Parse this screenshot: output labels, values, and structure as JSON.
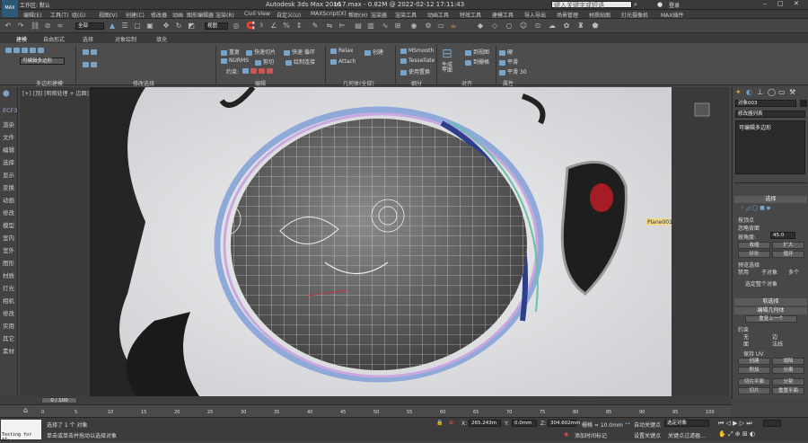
{
  "title": {
    "app": "Autodesk 3ds Max 2016",
    "file": "n17.max - 0.82M @ 2022-02-12 17:11:43",
    "workspace": "工作区: 默认",
    "search_placeholder": "键入关键字或短语",
    "login": "登录"
  },
  "menu": [
    "编辑(E)",
    "工具(T)",
    "组(G)",
    "视图(V)",
    "创建(C)",
    "修改器",
    "动画",
    "图形编辑器",
    "渲染(R)",
    "Civil View",
    "自定义(U)",
    "MAXScript(X)",
    "帮助(H)",
    "渲染器",
    "渲染工具",
    "动画工具",
    "特效工具",
    "建模工具",
    "导入导出",
    "场景管理",
    "材质贴图",
    "灯光摄像机",
    "MAX插件"
  ],
  "toolbar": {
    "selection_filter": "全部",
    "view_dropdown": "视图",
    "snap_count": "3"
  },
  "ribbon_tabs": [
    "建模",
    "自由形式",
    "选择",
    "对象绘制",
    "填充"
  ],
  "ribbon": {
    "groups": [
      "多边形建模",
      "修改选择",
      "编辑",
      "几何体(全部)",
      "细分",
      "对齐",
      "属性"
    ],
    "edit": [
      "重复",
      "快速切片",
      "快速 循环",
      "NURMS",
      "剪切",
      "绘制连接",
      "约束:"
    ],
    "geometry": [
      "Relax",
      "创建",
      "Attach"
    ],
    "subdivide": [
      "MSmooth",
      "Tessellate",
      "使用置换"
    ],
    "align": [
      "生成平面",
      "到视图",
      "到栅格"
    ],
    "props": [
      "硬",
      "平滑",
      "平滑 30"
    ],
    "poly_mode": "可编辑多边形"
  },
  "left_panel": [
    "渲染",
    "文件",
    "编辑",
    "选择",
    "显示",
    "变换",
    "动画",
    "修改",
    "模型",
    "室内",
    "室外",
    "图形",
    "材质",
    "灯光",
    "相机",
    "修改",
    "实用",
    "其它",
    "素材"
  ],
  "viewport": {
    "label": "[+] [顶] [明暗处理 + 边面]",
    "object_label": "Plane001"
  },
  "right_panel": {
    "object_name": "对象003",
    "modifier_list": "修改器列表",
    "stack_item": "可编辑多边形",
    "selection_header": "选择",
    "selection_options": [
      "按顶点",
      "忽略背面",
      "按角度:"
    ],
    "angle": "45.0",
    "btns1": [
      "收缩",
      "扩大",
      "环形",
      "循环"
    ],
    "preview": "预览选择",
    "preview_opts": [
      "禁用",
      "子对象",
      "多个"
    ],
    "selected": "选定整个对象",
    "soft_header": "软选择",
    "edit_geom_header": "编辑几何体",
    "repeat": "重复上一个",
    "constraint": "约束",
    "constraint_opts": [
      "无",
      "边",
      "面",
      "法线"
    ],
    "keep_uv": "保持 UV",
    "btns2": [
      "创建",
      "塌陷",
      "附加",
      "分离",
      "切片平面",
      "分割",
      "切片",
      "重置平面",
      "快速切片",
      "切割",
      "网格平滑",
      "细化"
    ]
  },
  "timeline": {
    "frame": "0 / 100",
    "ticks": [
      "0",
      "5",
      "10",
      "15",
      "20",
      "25",
      "30",
      "35",
      "40",
      "45",
      "50",
      "55",
      "60",
      "65",
      "70",
      "75",
      "80",
      "85",
      "90",
      "95",
      "100"
    ]
  },
  "status": {
    "selected": "选择了 1 个 对象",
    "hint": "单击或单击并拖动以选择对象",
    "x": "265.243m",
    "y": "0.0mm",
    "z": "304.602mm",
    "grid": "栅格 = 10.0mm",
    "add_tag": "添加时间标记",
    "auto_key": "自动关键点",
    "set_key": "设置关键点",
    "selection_set": "选定对象",
    "key_filters": "关键点过滤器...",
    "maxscript": "Testing for AI:"
  }
}
